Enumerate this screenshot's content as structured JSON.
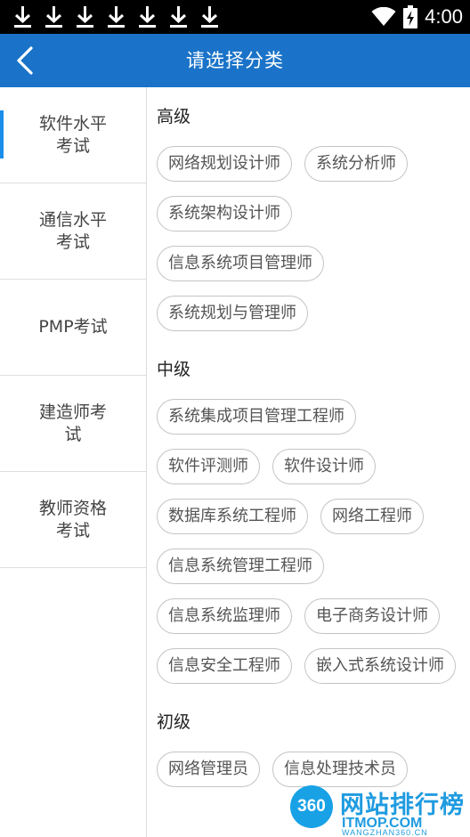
{
  "status_bar": {
    "time": "4:00",
    "download_icons": [
      "download-icon",
      "download-icon",
      "download-icon",
      "download-icon",
      "download-icon",
      "download-icon",
      "download-icon"
    ],
    "wifi_icon": "wifi-icon",
    "battery_icon": "battery-charging-icon"
  },
  "header": {
    "title": "请选择分类",
    "back_icon": "chevron-left-icon",
    "color": "#1a73c8"
  },
  "sidebar": {
    "items": [
      {
        "label": "软件水平考试",
        "active": true
      },
      {
        "label": "通信水平考试",
        "active": false
      },
      {
        "label": "PMP考试",
        "active": false
      },
      {
        "label": "建造师考试",
        "active": false
      },
      {
        "label": "教师资格考试",
        "active": false
      }
    ],
    "accent": "#1a8ee8"
  },
  "sections": [
    {
      "title": "高级",
      "items": [
        "网络规划设计师",
        "系统分析师",
        "系统架构设计师",
        "信息系统项目管理师",
        "系统规划与管理师"
      ]
    },
    {
      "title": "中级",
      "items": [
        "系统集成项目管理工程师",
        "软件评测师",
        "软件设计师",
        "数据库系统工程师",
        "网络工程师",
        "信息系统管理工程师",
        "信息系统监理师",
        "电子商务设计师",
        "信息安全工程师",
        "嵌入式系统设计师"
      ]
    },
    {
      "title": "初级",
      "items": [
        "网络管理员",
        "信息处理技术员"
      ]
    }
  ],
  "watermark": {
    "badge": "360",
    "text": "网站排行榜",
    "domain": "ITMOP.COM",
    "subdomain": "WANGZHAN360.CN"
  }
}
